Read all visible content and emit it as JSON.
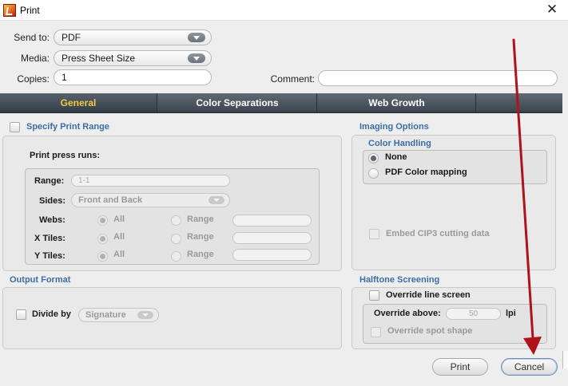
{
  "window": {
    "title": "Print",
    "close_glyph": "✕",
    "icon": "app-logo-icon"
  },
  "form": {
    "send_to_label": "Send to:",
    "send_to_value": "PDF",
    "media_label": "Media:",
    "media_value": "Press Sheet Size",
    "copies_label": "Copies:",
    "copies_value": "1",
    "comment_label": "Comment:",
    "comment_value": ""
  },
  "tabs": [
    {
      "label": "General",
      "active": true
    },
    {
      "label": "Color Separations",
      "active": false
    },
    {
      "label": "Web Growth",
      "active": false
    }
  ],
  "print_range": {
    "checkbox_label": "Specify Print Range",
    "checked": false,
    "group_label": "Print press runs:",
    "range_label": "Range:",
    "range_value": "1-1",
    "sides_label": "Sides:",
    "sides_value": "Front and Back",
    "rows": [
      {
        "label": "Webs:",
        "all": "All",
        "range": "Range"
      },
      {
        "label": "X Tiles:",
        "all": "All",
        "range": "Range"
      },
      {
        "label": "Y Tiles:",
        "all": "All",
        "range": "Range"
      }
    ]
  },
  "imaging_options": {
    "title": "Imaging Options",
    "color_handling_title": "Color Handling",
    "option_none": "None",
    "option_pdf": "PDF Color mapping",
    "selected": "None",
    "embed_cip3": "Embed CIP3 cutting data"
  },
  "output_format": {
    "title": "Output Format",
    "divide_by_label": "Divide by",
    "divide_by_value": "Signature"
  },
  "halftone": {
    "title": "Halftone Screening",
    "override_line_screen": "Override line screen",
    "override_above_label": "Override above:",
    "override_above_value": "50",
    "override_above_unit": "lpi",
    "override_spot_shape": "Override spot shape"
  },
  "buttons": {
    "print": "Print",
    "cancel": "Cancel"
  },
  "annotation": {
    "arrow_color": "#b0121b"
  },
  "colors": {
    "accent_blue": "#3a6ea5",
    "tab_active_text": "#f5c842",
    "tab_bar": "#4a545e"
  }
}
